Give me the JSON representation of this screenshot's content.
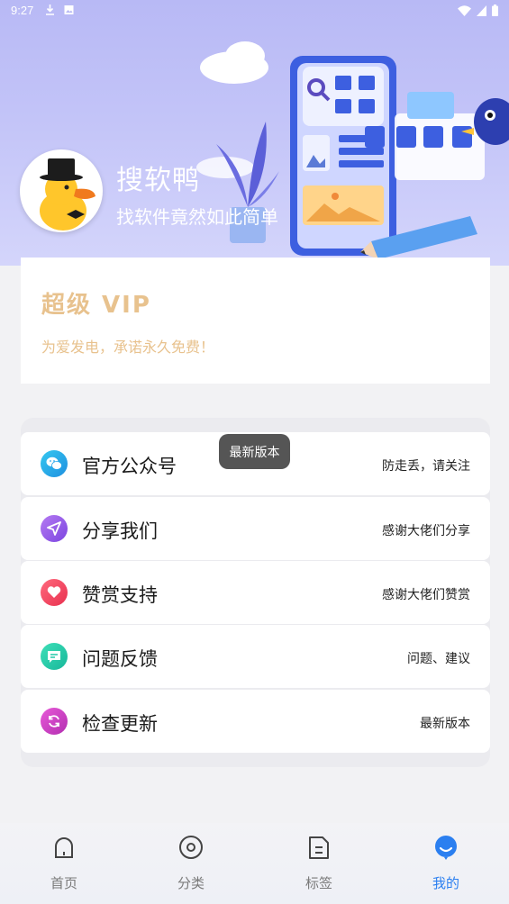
{
  "status_bar": {
    "time": "9:27"
  },
  "header": {
    "app_name": "搜软鸭",
    "slogan": "找软件竟然如此简单"
  },
  "vip": {
    "title": "超级 VIP",
    "subtitle": "为爱发电，承诺永久免费！"
  },
  "toast": {
    "text": "最新版本"
  },
  "menu": {
    "items": [
      {
        "label": "官方公众号",
        "hint": "防走丢，请关注",
        "icon": "wechat-icon",
        "color": "#1fb6e8"
      },
      {
        "label": "分享我们",
        "hint": "感谢大佬们分享",
        "icon": "send-icon",
        "color": "#9b5ce6"
      },
      {
        "label": "赞赏支持",
        "hint": "感谢大佬们赞赏",
        "icon": "heart-icon",
        "color": "#f0435f"
      },
      {
        "label": "问题反馈",
        "hint": "问题、建议",
        "icon": "feedback-icon",
        "color": "#22c9a8"
      },
      {
        "label": "检查更新",
        "hint": "最新版本",
        "icon": "refresh-icon",
        "color": "#d23dc4"
      }
    ]
  },
  "bottom_nav": {
    "items": [
      {
        "label": "首页",
        "icon": "home-icon"
      },
      {
        "label": "分类",
        "icon": "category-icon"
      },
      {
        "label": "标签",
        "icon": "tag-icon"
      },
      {
        "label": "我的",
        "icon": "profile-icon",
        "active": true
      }
    ],
    "active_color": "#2b7ff0"
  },
  "colors": {
    "vip_gold": "#e8c28e",
    "banner": "#b8b9f5"
  }
}
